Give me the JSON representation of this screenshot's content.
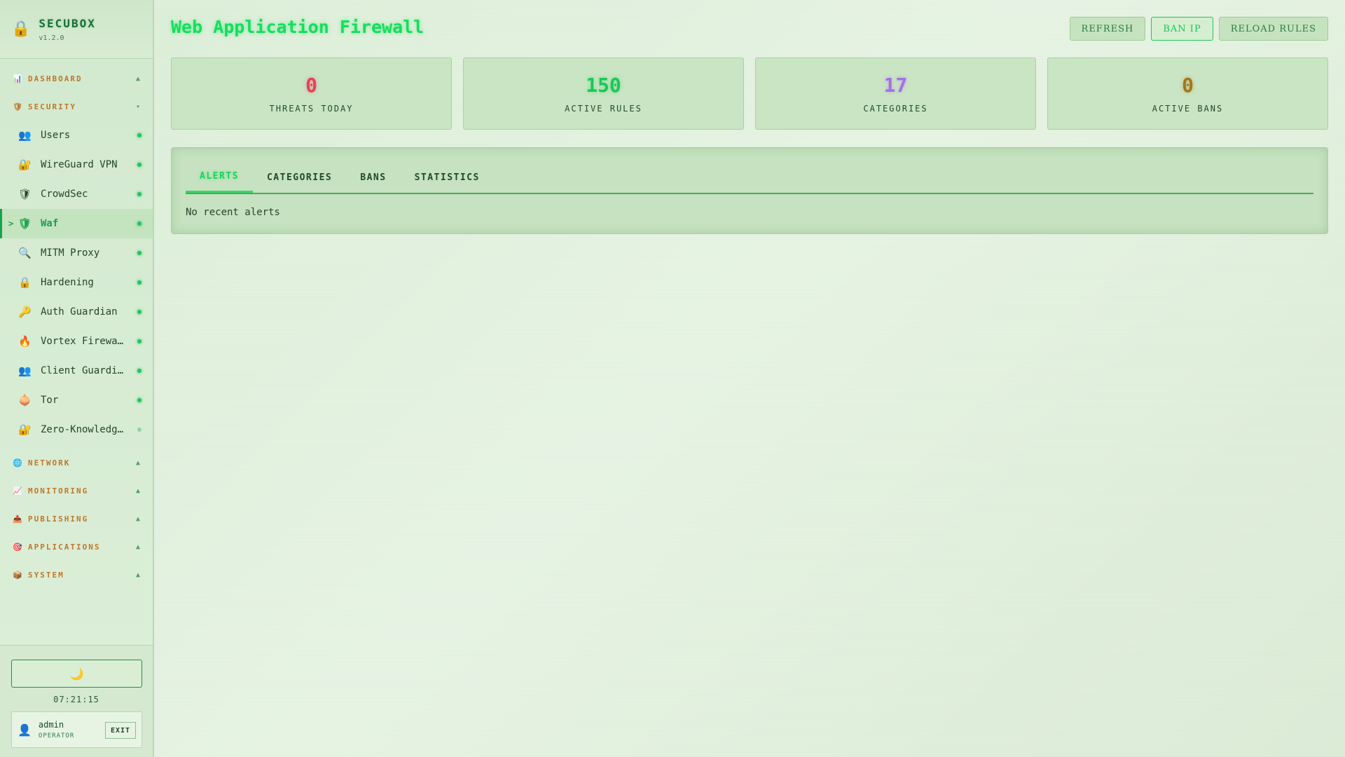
{
  "brand": {
    "name": "SECUBOX",
    "version": "v1.2.0"
  },
  "sidebar": {
    "sections_top": [
      {
        "icon": "📊",
        "icon_name": "chart-icon",
        "label": "DASHBOARD",
        "caret": "▲"
      },
      {
        "icon": "🛡",
        "icon_name": "shield-icon",
        "label": "SECURITY",
        "caret": "▾"
      }
    ],
    "items": [
      {
        "icon": "👥",
        "icon_name": "users-icon",
        "label": "Users"
      },
      {
        "icon": "🔐",
        "icon_name": "lock-key-icon",
        "label": "WireGuard VPN"
      },
      {
        "icon": "🛡",
        "icon_name": "shield-icon",
        "label": "CrowdSec"
      },
      {
        "icon": "🛡",
        "icon_name": "shield-icon",
        "label": "Waf"
      },
      {
        "icon": "🔍",
        "icon_name": "magnifier-icon",
        "label": "MITM Proxy"
      },
      {
        "icon": "🔒",
        "icon_name": "lock-icon",
        "label": "Hardening"
      },
      {
        "icon": "🔑",
        "icon_name": "key-icon",
        "label": "Auth Guardian"
      },
      {
        "icon": "🔥",
        "icon_name": "fire-icon",
        "label": "Vortex Firewall"
      },
      {
        "icon": "👥",
        "icon_name": "users-icon",
        "label": "Client Guardian"
      },
      {
        "icon": "🧅",
        "icon_name": "onion-icon",
        "label": "Tor"
      },
      {
        "icon": "🔐",
        "icon_name": "lock-key-icon",
        "label": "Zero-Knowledge Proofs"
      }
    ],
    "active_marker": ">",
    "sections_bottom": [
      {
        "icon": "🌐",
        "icon_name": "globe-icon",
        "label": "NETWORK",
        "caret": "▲"
      },
      {
        "icon": "📈",
        "icon_name": "line-chart-icon",
        "label": "MONITORING",
        "caret": "▲"
      },
      {
        "icon": "📤",
        "icon_name": "outbox-icon",
        "label": "PUBLISHING",
        "caret": "▲"
      },
      {
        "icon": "🎯",
        "icon_name": "target-icon",
        "label": "APPLICATIONS",
        "caret": "▲"
      },
      {
        "icon": "📦",
        "icon_name": "package-icon",
        "label": "SYSTEM",
        "caret": "▲"
      }
    ],
    "theme_toggle": "🌙",
    "clock": "07:21:15",
    "user": {
      "icon": "👤",
      "name": "admin",
      "role": "OPERATOR",
      "exit_label": "EXIT"
    }
  },
  "header": {
    "title": "Web Application Firewall",
    "buttons": {
      "refresh": "REFRESH",
      "ban_ip": "BAN IP",
      "reload_rules": "RELOAD RULES"
    }
  },
  "stats": [
    {
      "value": "0",
      "label": "THREATS TODAY",
      "color": "#e8405a"
    },
    {
      "value": "150",
      "label": "ACTIVE RULES",
      "color": "#18c957"
    },
    {
      "value": "17",
      "label": "CATEGORIES",
      "color": "#a66ee8"
    },
    {
      "value": "0",
      "label": "ACTIVE BANS",
      "color": "#a3761c"
    }
  ],
  "tabs": [
    "ALERTS",
    "CATEGORIES",
    "BANS",
    "STATISTICS"
  ],
  "active_tab": "ALERTS",
  "alerts": {
    "empty_text": "No recent alerts"
  }
}
